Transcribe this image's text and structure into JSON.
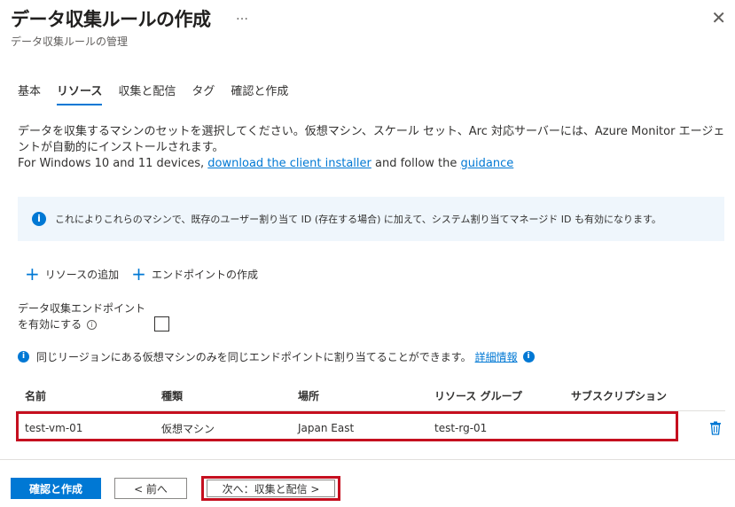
{
  "header": {
    "title": "データ収集ルールの作成",
    "more_label": "…",
    "subtitle": "データ収集ルールの管理",
    "close_label": "✕"
  },
  "tabs": [
    {
      "label": "基本",
      "active": false
    },
    {
      "label": "リソース",
      "active": true
    },
    {
      "label": "収集と配信",
      "active": false
    },
    {
      "label": "タグ",
      "active": false
    },
    {
      "label": "確認と作成",
      "active": false
    }
  ],
  "description": {
    "line1": "データを収集するマシンのセットを選択してください。仮想マシン、スケール セット、Arc 対応サーバーには、Azure Monitor エージェントが自動的にインストールされます。",
    "line2_prefix": "For Windows 10 and 11 devices, ",
    "line2_link1": "download the client installer",
    "line2_middle": " and follow the ",
    "line2_link2": "guidance"
  },
  "info_banner": {
    "icon": "info-icon",
    "text": "これによりこれらのマシンで、既存のユーザー割り当て ID (存在する場合) に加えて、システム割り当てマネージド ID も有効になります。"
  },
  "actions": {
    "add_resource": "リソースの追加",
    "create_endpoint": "エンドポイントの作成",
    "plus_glyph": "+"
  },
  "endpoint_toggle": {
    "label": "データ収集エンドポイントを有効にする",
    "info_glyph": "i",
    "checked": false
  },
  "region_note": {
    "text": "同じリージョンにある仮想マシンのみを同じエンドポイントに割り当てることができます。",
    "link": "詳細情報",
    "info_glyph": "i"
  },
  "table": {
    "columns": [
      "名前",
      "種類",
      "場所",
      "リソース グループ",
      "サブスクリプション"
    ],
    "rows": [
      {
        "name": "test-vm-01",
        "type": "仮想マシン",
        "location": "Japan East",
        "resource_group": "test-rg-01",
        "subscription": ""
      }
    ]
  },
  "footer": {
    "review_create": "確認と作成",
    "previous": "< 前へ",
    "next": "次へ：収集と配信 >"
  },
  "colors": {
    "accent": "#0078d4",
    "highlight": "#c50f1f",
    "info_bg": "#eff6fc"
  }
}
